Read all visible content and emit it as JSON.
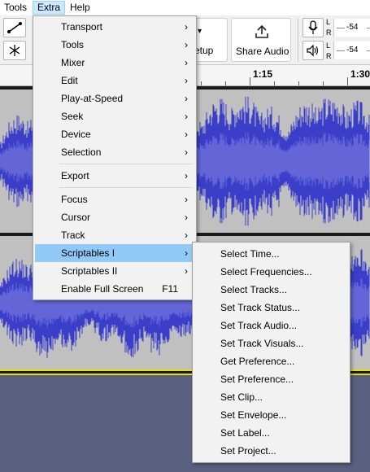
{
  "menubar": {
    "items": [
      {
        "label": "Tools"
      },
      {
        "label": "Extra"
      },
      {
        "label": "Help"
      }
    ]
  },
  "toolbar": {
    "setup_label": "etup",
    "share_audio_label": "Share Audio",
    "meter_lr": [
      "L",
      "R"
    ],
    "meter_values": [
      "-54",
      "-54"
    ],
    "meter_values_2": [
      "-54",
      "-54"
    ]
  },
  "ruler": {
    "ticks": [
      "1:15",
      "1:30"
    ]
  },
  "extra_menu": {
    "items": [
      {
        "label": "Transport",
        "submenu": true
      },
      {
        "label": "Tools",
        "submenu": true
      },
      {
        "label": "Mixer",
        "submenu": true
      },
      {
        "label": "Edit",
        "submenu": true
      },
      {
        "label": "Play-at-Speed",
        "submenu": true
      },
      {
        "label": "Seek",
        "submenu": true
      },
      {
        "label": "Device",
        "submenu": true
      },
      {
        "label": "Selection",
        "submenu": true
      },
      {
        "label": "Export",
        "submenu": true
      },
      {
        "label": "Focus",
        "submenu": true
      },
      {
        "label": "Cursor",
        "submenu": true
      },
      {
        "label": "Track",
        "submenu": true
      },
      {
        "label": "Scriptables I",
        "submenu": true,
        "highlighted": true
      },
      {
        "label": "Scriptables II",
        "submenu": true
      },
      {
        "label": "Enable Full Screen",
        "shortcut": "F11"
      }
    ]
  },
  "scriptables_menu": {
    "items": [
      {
        "label": "Select Time..."
      },
      {
        "label": "Select Frequencies..."
      },
      {
        "label": "Select Tracks..."
      },
      {
        "label": "Set Track Status..."
      },
      {
        "label": "Set Track Audio..."
      },
      {
        "label": "Set Track Visuals..."
      },
      {
        "label": "Get Preference..."
      },
      {
        "label": "Set Preference..."
      },
      {
        "label": "Set Clip..."
      },
      {
        "label": "Set Envelope..."
      },
      {
        "label": "Set Label..."
      },
      {
        "label": "Set Project..."
      }
    ]
  },
  "colors": {
    "waveform": "#3b3ec8",
    "waveform_light": "#6466d8",
    "track_bg": "#c0c0c0",
    "menu_highlight": "#91c9f7",
    "empty_area": "#5a6080"
  },
  "icons": {
    "envelope_tool": "envelope-icon",
    "multi_tool": "asterisk-icon",
    "share": "share-upload-icon",
    "microphone": "microphone-icon",
    "speaker": "speaker-icon",
    "submenu_arrow": "chevron-right-icon"
  }
}
